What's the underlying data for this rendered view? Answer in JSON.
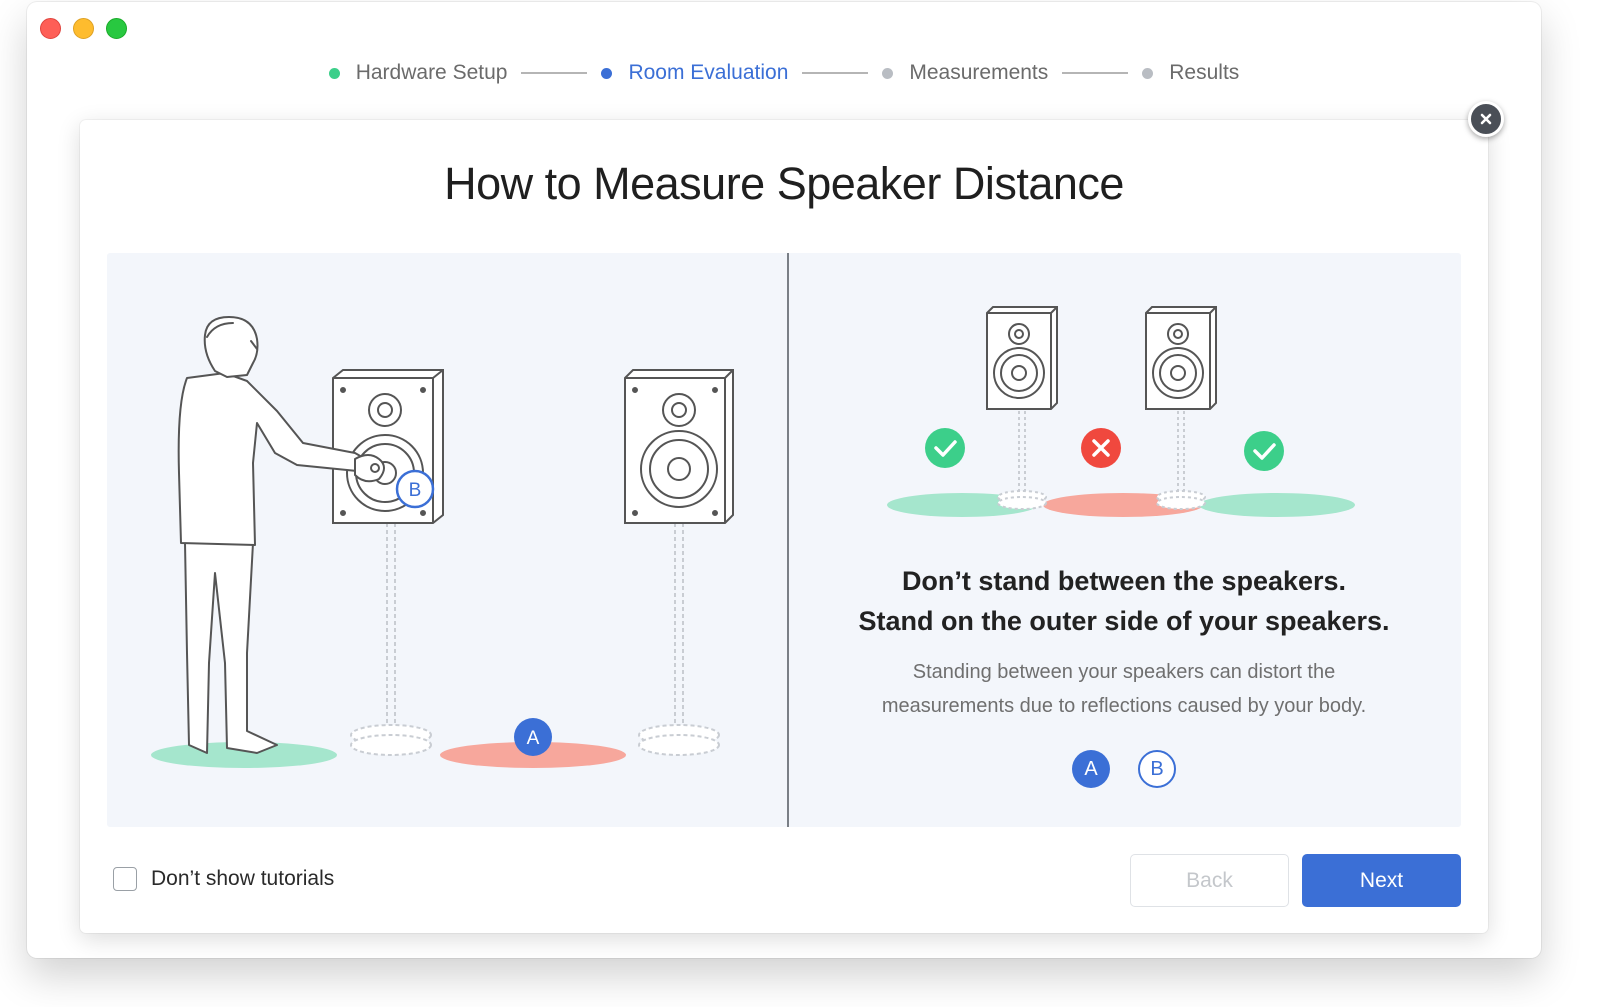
{
  "steps": [
    {
      "label": "Hardware Setup",
      "state": "done"
    },
    {
      "label": "Room Evaluation",
      "state": "active"
    },
    {
      "label": "Measurements",
      "state": "todo"
    },
    {
      "label": "Results",
      "state": "todo"
    }
  ],
  "tutorial": {
    "title": "How to Measure Speaker Distance",
    "headline_line1": "Don’t stand between the speakers.",
    "headline_line2": "Stand on the outer side of your speakers.",
    "description_line1": "Standing between your speakers can distort the",
    "description_line2": "measurements due to reflections caused by your body.",
    "badge_a": "A",
    "badge_b": "B",
    "illustration_badge_a": "A",
    "illustration_badge_b": "B"
  },
  "footer": {
    "dont_show_label": "Don’t show tutorials",
    "dont_show_checked": false,
    "back_label": "Back",
    "next_label": "Next"
  },
  "colors": {
    "accent": "#3b6fd6",
    "done": "#3ccf8a",
    "good_zone": "#a5e6cd",
    "bad_zone": "#f7a79c",
    "error": "#f0483e"
  }
}
